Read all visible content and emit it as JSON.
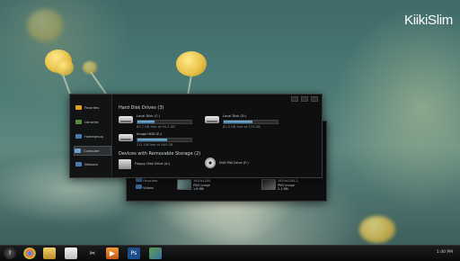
{
  "brand": "KiikiSlim",
  "window_main": {
    "sidebar": [
      {
        "label": "Favorites",
        "icon": "star-icon",
        "color": "#e0a020"
      },
      {
        "label": "Libraries",
        "icon": "libraries-icon",
        "color": "#5a8a40"
      },
      {
        "label": "Homegroup",
        "icon": "homegroup-icon",
        "color": "#4a7bb0"
      },
      {
        "label": "Computer",
        "icon": "computer-icon",
        "color": "#6aa0d0"
      },
      {
        "label": "Network",
        "icon": "network-icon",
        "color": "#4a7bb0"
      }
    ],
    "section_hdd": "Hard Disk Drives (3)",
    "drives": [
      {
        "name": "Local Disk (C:)",
        "free": "63.7 GB free of 94.3 GB",
        "fill": 0.32
      },
      {
        "name": "Local Disk (D:)",
        "free": "81.0 GB free of 174 GB",
        "fill": 0.53
      },
      {
        "name": "Image HDD (E:)",
        "free": "211 GB free of 465 GB",
        "fill": 0.55
      }
    ],
    "section_removable": "Devices with Removable Storage (2)",
    "removable": [
      {
        "name": "Floppy Disk Drive (A:)"
      },
      {
        "name": "DVD RW Drive (F:)"
      }
    ]
  },
  "window_back": {
    "items": [
      {
        "label": "Favorites"
      },
      {
        "label": "Videos"
      }
    ],
    "files": [
      {
        "name": "1920x1200",
        "type": "PNG image",
        "size": "1.6 MB"
      },
      {
        "name": "1920x1200-2",
        "type": "PNG image",
        "size": "2.1 MB"
      }
    ]
  },
  "taskbar": {
    "clock": "1:40 PM",
    "apps": [
      {
        "icon": "start-icon",
        "color": "#222"
      },
      {
        "icon": "chrome-icon",
        "color": "#c0392b"
      },
      {
        "icon": "explorer-icon",
        "color": "#d8b545"
      },
      {
        "icon": "notepad-icon",
        "color": "#dcdcdc"
      },
      {
        "icon": "tools-icon",
        "color": "#444"
      },
      {
        "icon": "media-player-icon",
        "color": "#e07a20"
      },
      {
        "icon": "photoshop-icon",
        "color": "#1d4e89"
      },
      {
        "icon": "control-panel-icon",
        "color": "#5aa050"
      }
    ]
  }
}
